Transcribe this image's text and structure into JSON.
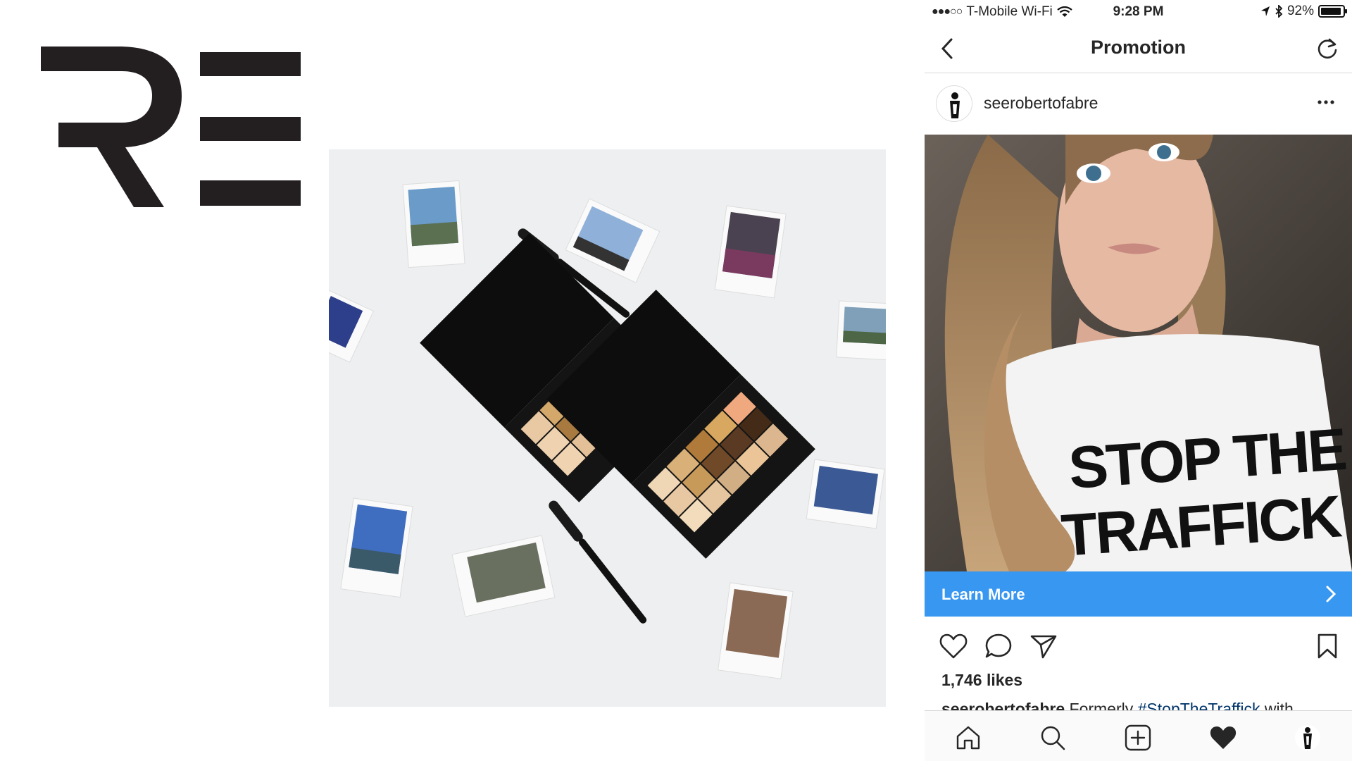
{
  "status_bar": {
    "signal_dots": "●●●○○",
    "carrier": "T-Mobile Wi-Fi",
    "time": "9:28 PM",
    "battery": "92%",
    "battery_level": 0.92
  },
  "nav": {
    "title": "Promotion"
  },
  "post": {
    "username": "seerobertofabre",
    "image_shirt_text_line1": "STOP THE",
    "image_shirt_text_line2": "TRAFFICK",
    "cta_label": "Learn More",
    "likes": "1,746 likes",
    "caption_user": "seerobertofabre",
    "caption_text": " Formerly ",
    "caption_hashtag": "#StopTheTraffick",
    "caption_rest": " with"
  },
  "colors": {
    "cta_blue": "#3897f0",
    "logo_black": "#231f20",
    "hashtag_blue": "#003569"
  },
  "icons": {
    "back": "chevron-left-icon",
    "refresh": "refresh-icon",
    "more": "more-dots-icon",
    "like": "heart-outline-icon",
    "comment": "comment-icon",
    "share": "send-icon",
    "save": "bookmark-icon",
    "home": "home-icon",
    "search": "search-icon",
    "add": "add-post-icon",
    "activity": "heart-filled-icon",
    "profile": "profile-avatar-icon"
  }
}
